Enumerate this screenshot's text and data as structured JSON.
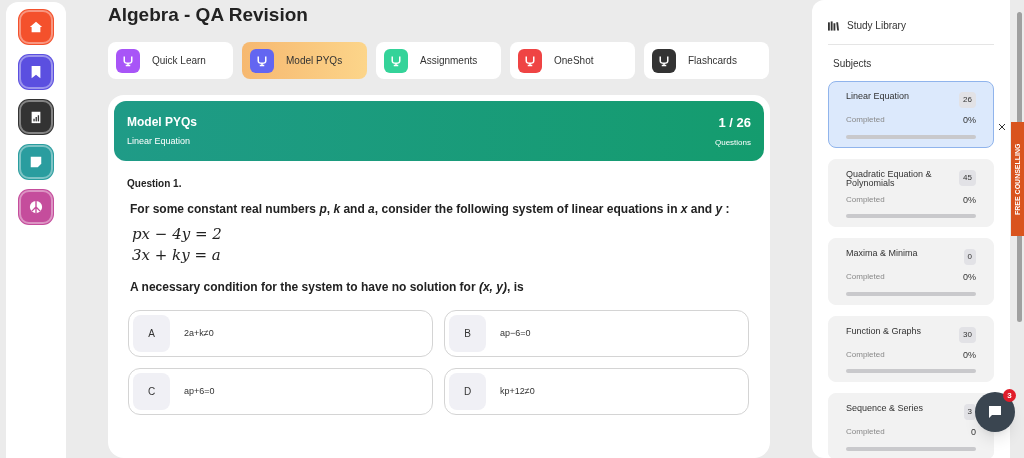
{
  "nav_rail": [
    {
      "kind": "home",
      "color": "#f4512c",
      "selected": false
    },
    {
      "kind": "bookmark",
      "color": "#5b4fe0",
      "selected": false
    },
    {
      "kind": "clipboard",
      "color": "#333333",
      "selected": false
    },
    {
      "kind": "note",
      "color": "#2a9d9f",
      "selected": false
    },
    {
      "kind": "peace",
      "color": "#c54d9c",
      "selected": false
    }
  ],
  "page_title": "Algebra - QA Revision",
  "tabs": [
    {
      "label": "Quick Learn",
      "color": "#a855f7",
      "selected": false
    },
    {
      "label": "Model PYQs",
      "color": "#6366f1",
      "selected": true
    },
    {
      "label": "Assignments",
      "color": "#34d399",
      "selected": false
    },
    {
      "label": "OneShot",
      "color": "#ef4444",
      "selected": false
    },
    {
      "label": "Flashcards",
      "color": "#333333",
      "selected": false
    }
  ],
  "question_card": {
    "title": "Model PYQs",
    "subtitle": "Linear Equation",
    "counter": "1 / 26",
    "counter_label": "Questions",
    "question_number": "Question 1.",
    "stem": "For some constant real numbers *p*, *k* and *a*, consider the following system of linear equations in *x* and *y* :",
    "equations": [
      "px − 4y = 2",
      "3x + ky = a"
    ],
    "prompt": "A necessary condition for the system to have no solution for *(x, y)*, is",
    "options": [
      {
        "letter": "A",
        "text": "2a+k≠0",
        "selected": false
      },
      {
        "letter": "B",
        "text": "ap−6=0",
        "selected": false
      },
      {
        "letter": "C",
        "text": "ap+6=0",
        "selected": false
      },
      {
        "letter": "D",
        "text": "kp+12≠0",
        "selected": false
      }
    ]
  },
  "study_library": {
    "title": "Study Library",
    "section": "Subjects",
    "subjects": [
      {
        "name": "Linear Equation",
        "count": "26",
        "status": "Completed",
        "percent": "0%",
        "level": 0,
        "selected": true
      },
      {
        "name": "Quadratic Equation & Polynomials",
        "count": "45",
        "status": "Completed",
        "percent": "0%",
        "level": 0,
        "selected": false
      },
      {
        "name": "Maxima & Minima",
        "count": "0",
        "status": "Completed",
        "percent": "0%",
        "level": 0,
        "selected": false
      },
      {
        "name": "Function & Graphs",
        "count": "30",
        "status": "Completed",
        "percent": "0%",
        "level": 0,
        "selected": false
      },
      {
        "name": "Sequence & Series",
        "count": "3",
        "status": "Completed",
        "percent": "0",
        "level": 0,
        "selected": false
      }
    ]
  },
  "side_tab": {
    "label": "FREE COUNSELLING"
  },
  "chat": {
    "badge": "3"
  }
}
